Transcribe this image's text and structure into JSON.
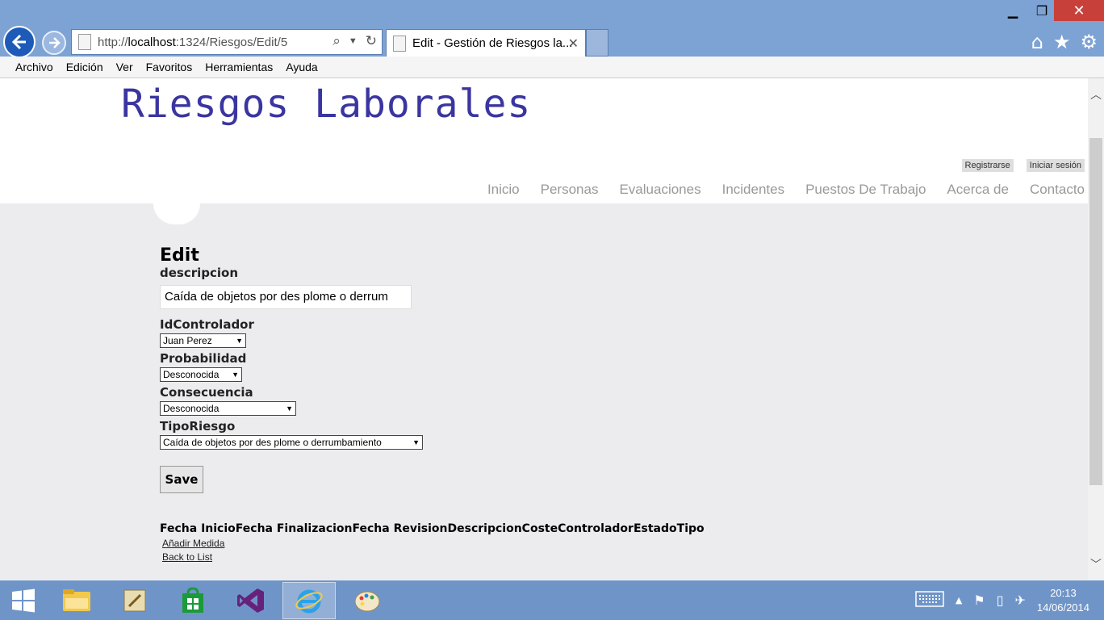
{
  "browser": {
    "url_prefix": "http://",
    "url_host": "localhost",
    "url_path": ":1324/Riesgos/Edit/5",
    "tab_title": "Edit - Gestión de Riesgos la...",
    "menu": [
      "Archivo",
      "Edición",
      "Ver",
      "Favoritos",
      "Herramientas",
      "Ayuda"
    ]
  },
  "site": {
    "title": "Riesgos Laborales",
    "register": "Registrarse",
    "login": "Iniciar sesión",
    "nav": [
      "Inicio",
      "Personas",
      "Evaluaciones",
      "Incidentes",
      "Puestos De Trabajo",
      "Acerca de",
      "Contacto"
    ]
  },
  "form": {
    "heading": "Edit",
    "descripcion_label": "descripcion",
    "descripcion_value": "Caída de objetos por des plome o derrum",
    "controlador_label": "IdControlador",
    "controlador_value": "Juan Perez",
    "probabilidad_label": "Probabilidad",
    "probabilidad_value": "Desconocida",
    "consecuencia_label": "Consecuencia",
    "consecuencia_value": "Desconocida",
    "tiporiesgo_label": "TipoRiesgo",
    "tiporiesgo_value": "Caída de objetos por des plome o derrumbamiento",
    "save_label": "Save"
  },
  "table": {
    "columns": [
      "Fecha Inicio",
      "Fecha Finalizacion",
      "Fecha Revision",
      "Descripcion",
      "Coste",
      "Controlador",
      "Estado",
      "Tipo"
    ]
  },
  "links": {
    "add": "Añadir Medida",
    "back": "Back to List"
  },
  "taskbar": {
    "time": "20:13",
    "date": "14/06/2014"
  }
}
